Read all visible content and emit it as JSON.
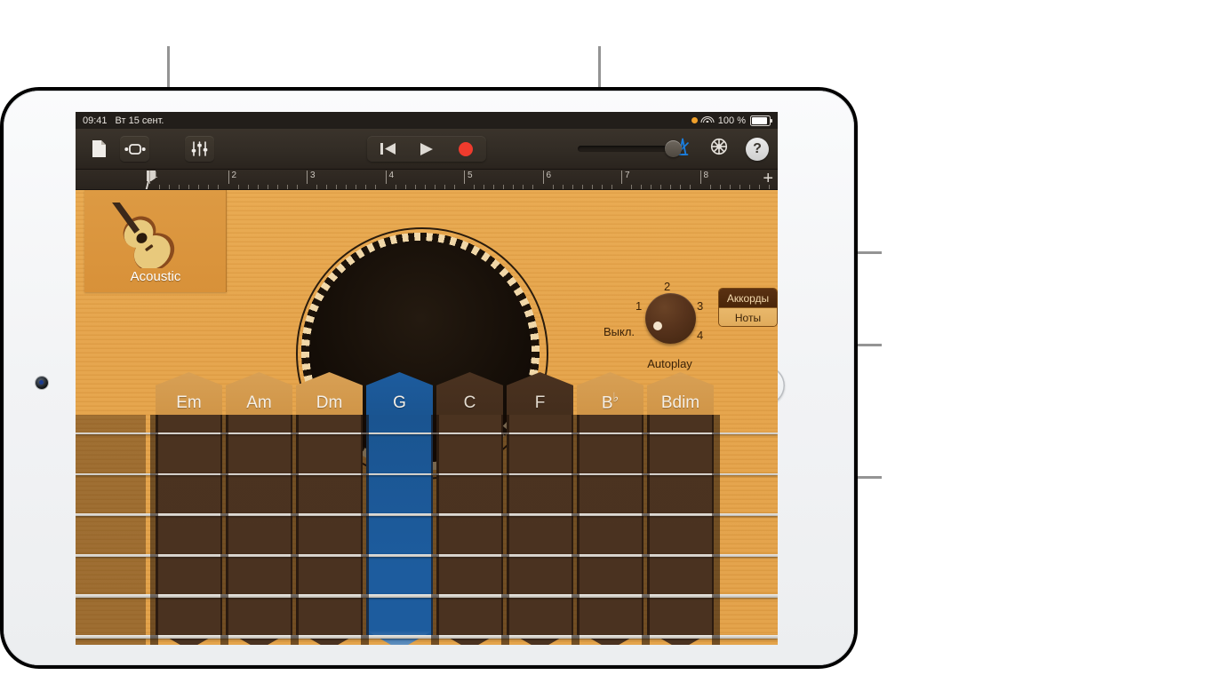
{
  "status_bar": {
    "time": "09:41",
    "date": "Вт 15 сент.",
    "battery_percent": "100 %",
    "wifi_icon": "wifi-icon",
    "recording_dot_icon": "orange-dot-icon",
    "battery_icon": "battery-icon"
  },
  "toolbar": {
    "browser_icon": "document-icon",
    "view_icon": "tracks-view-icon",
    "mixer_icon": "mixer-sliders-icon",
    "rewind_icon": "rewind-to-start-icon",
    "play_icon": "play-icon",
    "record_icon": "record-icon",
    "volume_label": "master-volume-slider",
    "metronome_icon": "metronome-icon",
    "settings_icon": "gear-icon",
    "help_label": "?",
    "accent_blue": "#1b7fe0",
    "record_red": "#ef3b2d"
  },
  "ruler": {
    "bars": [
      "1",
      "2",
      "3",
      "4",
      "5",
      "6",
      "7",
      "8"
    ],
    "add_track_label": "+",
    "playhead_position_bar": "1"
  },
  "instrument": {
    "name": "Acoustic",
    "glyph": "acoustic-guitar-icon"
  },
  "autoplay": {
    "caption": "Autoplay",
    "off_label": "Выкл.",
    "positions": [
      "1",
      "2",
      "3",
      "4"
    ],
    "selected": "Выкл."
  },
  "mode_toggle": {
    "chords_label": "Аккорды",
    "notes_label": "Ноты",
    "selected": "Аккорды"
  },
  "chord_strip": {
    "chords": [
      {
        "root": "Em",
        "accidental": "",
        "state": "normal"
      },
      {
        "root": "Am",
        "accidental": "",
        "state": "normal"
      },
      {
        "root": "Dm",
        "accidental": "",
        "state": "normal"
      },
      {
        "root": "G",
        "accidental": "",
        "state": "active"
      },
      {
        "root": "C",
        "accidental": "",
        "state": "dim"
      },
      {
        "root": "F",
        "accidental": "",
        "state": "dim"
      },
      {
        "root": "B",
        "accidental": "♭",
        "state": "normal"
      },
      {
        "root": "Bdim",
        "accidental": "",
        "state": "normal"
      }
    ],
    "active_chord": "G",
    "string_count": 6
  },
  "colors": {
    "wood_top": "#e8a84e",
    "fretboard": "#4a3220",
    "active_blue": "#1d5c9e",
    "instrument_tile": "#dd9a43"
  }
}
